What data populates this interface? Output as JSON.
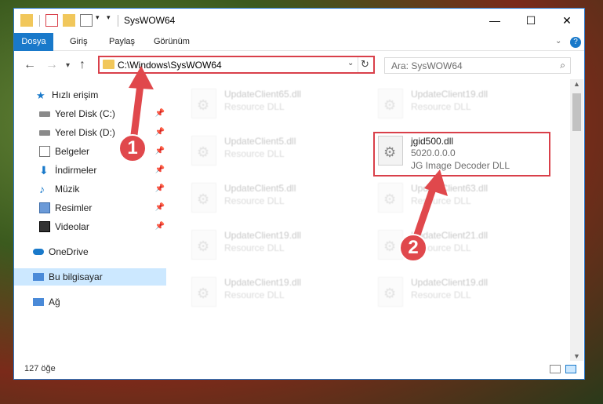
{
  "window": {
    "title": "SysWOW64"
  },
  "ribbon": {
    "tabs": [
      "Dosya",
      "Giriş",
      "Paylaş",
      "Görünüm"
    ]
  },
  "address": {
    "path": "C:\\Windows\\SysWOW64"
  },
  "search": {
    "placeholder": "Ara: SysWOW64"
  },
  "sidebar": {
    "items": [
      {
        "label": "Hızlı erişim",
        "icon": "star-icon"
      },
      {
        "label": "Yerel Disk (C:)",
        "icon": "drive-icon"
      },
      {
        "label": "Yerel Disk (D:)",
        "icon": "drive-icon"
      },
      {
        "label": "Belgeler",
        "icon": "documents-icon"
      },
      {
        "label": "İndirmeler",
        "icon": "download-icon"
      },
      {
        "label": "Müzik",
        "icon": "music-icon"
      },
      {
        "label": "Resimler",
        "icon": "pictures-icon"
      },
      {
        "label": "Videolar",
        "icon": "videos-icon"
      },
      {
        "label": "OneDrive",
        "icon": "cloud-icon"
      },
      {
        "label": "Bu bilgisayar",
        "icon": "computer-icon"
      },
      {
        "label": "Ağ",
        "icon": "network-icon"
      }
    ]
  },
  "files": {
    "left": [
      {
        "name": "UpdateClient65.dll",
        "desc": "Resource DLL"
      },
      {
        "name": "UpdateClient5.dll",
        "desc": "Resource DLL"
      },
      {
        "name": "UpdateClient5.dll",
        "desc": "Resource DLL"
      },
      {
        "name": "UpdateClient19.dll",
        "desc": "Resource DLL"
      },
      {
        "name": "UpdateClient19.dll",
        "desc": "Resource DLL"
      }
    ],
    "right": [
      {
        "name": "UpdateClient19.dll",
        "desc": "Resource DLL"
      },
      {
        "name": "UpdateClient63.dll",
        "desc": "Resource DLL"
      },
      {
        "name": "UpdateClient21.dll",
        "desc": "Resource DLL"
      },
      {
        "name": "UpdateClient19.dll",
        "desc": "Resource DLL"
      }
    ],
    "highlight": {
      "name": "jgid500.dll",
      "version": "5020.0.0.0",
      "desc": "JG Image Decoder DLL"
    }
  },
  "status": {
    "count": "127 öğe"
  },
  "annotations": {
    "badge1": "1",
    "badge2": "2"
  },
  "colors": {
    "accent": "#1979ca",
    "highlight_red": "#d9404a"
  }
}
